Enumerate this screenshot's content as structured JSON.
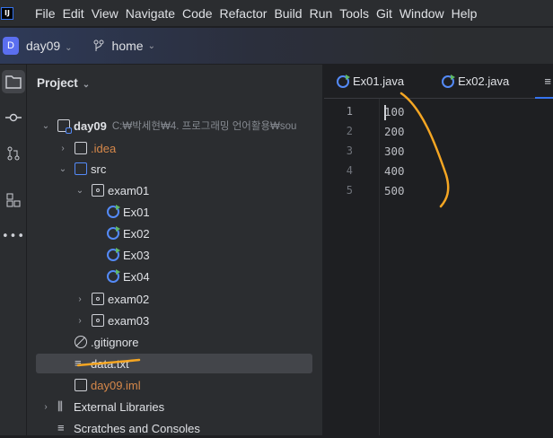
{
  "menubar": {
    "items": [
      "File",
      "Edit",
      "View",
      "Navigate",
      "Code",
      "Refactor",
      "Build",
      "Run",
      "Tools",
      "Git",
      "Window",
      "Help"
    ]
  },
  "header": {
    "project_initial": "D",
    "project": "day09",
    "branch": "home"
  },
  "panel": {
    "title": "Project"
  },
  "tree": [
    {
      "label": "day09",
      "path": "C:₩박세현₩4. 프로그래밍 언어활용₩sou",
      "icon": "module-folder-icon",
      "arrow": "⌄",
      "indent": 0
    },
    {
      "label": ".idea",
      "icon": "folder-icon",
      "arrow": "›",
      "indent": 1,
      "color": "#d6884a"
    },
    {
      "label": "src",
      "icon": "source-folder-icon",
      "arrow": "⌄",
      "indent": 1
    },
    {
      "label": "exam01",
      "icon": "package-icon",
      "arrow": "⌄",
      "indent": 2
    },
    {
      "label": "Ex01",
      "icon": "java-class-icon",
      "arrow": "",
      "indent": 3
    },
    {
      "label": "Ex02",
      "icon": "java-class-icon",
      "arrow": "",
      "indent": 3
    },
    {
      "label": "Ex03",
      "icon": "java-class-icon",
      "arrow": "",
      "indent": 3
    },
    {
      "label": "Ex04",
      "icon": "java-class-icon",
      "arrow": "",
      "indent": 3
    },
    {
      "label": "exam02",
      "icon": "package-icon",
      "arrow": "›",
      "indent": 2
    },
    {
      "label": "exam03",
      "icon": "package-icon",
      "arrow": "›",
      "indent": 2
    },
    {
      "label": ".gitignore",
      "icon": "ignore-file-icon",
      "arrow": "",
      "indent": 1
    },
    {
      "label": "data.txt",
      "icon": "text-file-icon",
      "arrow": "",
      "indent": 1,
      "selected": true
    },
    {
      "label": "day09.iml",
      "icon": "iml-file-icon",
      "arrow": "",
      "indent": 1,
      "color": "#d6884a"
    },
    {
      "label": "External Libraries",
      "icon": "library-icon",
      "arrow": "›",
      "indent": 0
    },
    {
      "label": "Scratches and Consoles",
      "icon": "scratches-icon",
      "arrow": "",
      "indent": 0
    }
  ],
  "editor": {
    "tabs": [
      "Ex01.java",
      "Ex02.java"
    ],
    "lines": [
      "100",
      "200",
      "300",
      "400",
      "500"
    ]
  },
  "colors": {
    "accent": "#3574f0",
    "annotation": "#f5a623"
  }
}
